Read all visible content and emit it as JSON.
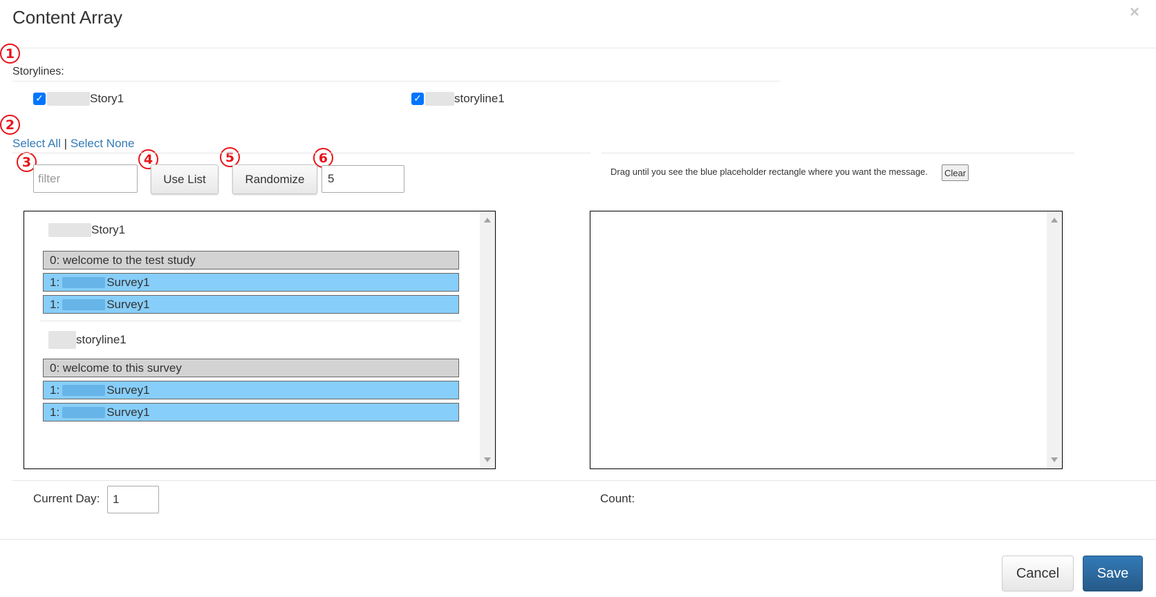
{
  "modal": {
    "title": "Content Array",
    "close_glyph": "×"
  },
  "markers": [
    "1",
    "2",
    "3",
    "4",
    "5",
    "6"
  ],
  "storylines": {
    "label": "Storylines:",
    "items": [
      {
        "label": "Story1",
        "checked": true
      },
      {
        "label": "storyline1",
        "checked": true
      }
    ]
  },
  "selection": {
    "select_all": "Select All",
    "separator": "|",
    "select_none": "Select None"
  },
  "controls": {
    "filter_placeholder": "filter",
    "use_list_label": "Use List",
    "randomize_label": "Randomize",
    "randomize_count": "5"
  },
  "drop_area": {
    "hint": "Drag until you see the blue placeholder rectangle where you want the message.",
    "clear_label": "Clear"
  },
  "message_list": {
    "groups": [
      {
        "title": "Story1",
        "items": [
          {
            "text": "0: welcome to the test study",
            "style": "gray"
          },
          {
            "prefix": "1:",
            "text": "Survey1",
            "style": "blue"
          },
          {
            "prefix": "1:",
            "text": "Survey1",
            "style": "blue"
          }
        ]
      },
      {
        "title": "storyline1",
        "items": [
          {
            "text": "0: welcome to this survey",
            "style": "gray"
          },
          {
            "prefix": "1:",
            "text": "Survey1",
            "style": "blue"
          },
          {
            "prefix": "1:",
            "text": "Survey1",
            "style": "blue"
          }
        ]
      }
    ]
  },
  "footer_fields": {
    "current_day_label": "Current Day:",
    "current_day_value": "1",
    "count_label": "Count:"
  },
  "buttons": {
    "cancel": "Cancel",
    "save": "Save"
  },
  "colors": {
    "marker": "#e8141b",
    "link": "#337ab7",
    "item_gray": "#d3d3d3",
    "item_blue": "#87cefa",
    "save_button": "#286090"
  }
}
